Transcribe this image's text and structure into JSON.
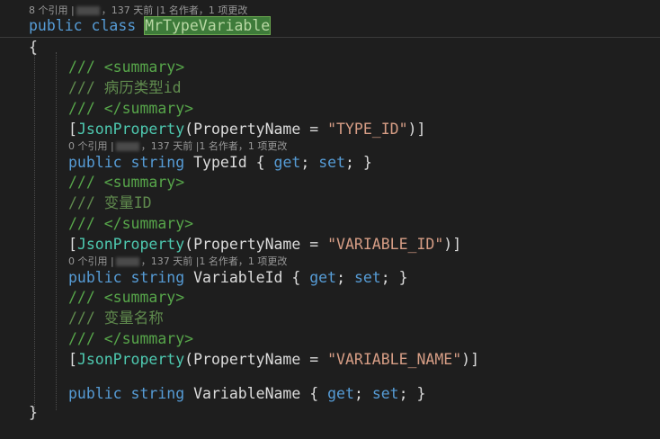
{
  "codelens": {
    "class": {
      "refs": "8 个引用",
      "sep1": "|",
      "time": "，137 天前",
      "sep2": "|",
      "authors": "1 名作者，1 项更改"
    },
    "typeid": {
      "refs": "0 个引用",
      "sep1": "|",
      "time": "，137 天前",
      "sep2": "|",
      "authors": "1 名作者，1 项更改"
    },
    "variableid": {
      "refs": "0 个引用",
      "sep1": "|",
      "time": "，137 天前",
      "sep2": "|",
      "authors": "1 名作者，1 项更改"
    }
  },
  "code": {
    "public": "public",
    "class": "class",
    "string": "string",
    "class_name": "MrTypeVariable",
    "open_brace": "{",
    "close_brace": "}",
    "summary_open": "/// <summary>",
    "summary_close": "/// </summary>",
    "json_property": "JsonProperty",
    "property_name": "PropertyName",
    "members": [
      {
        "comment": "/// 病历类型id",
        "json_value": "\"TYPE_ID\"",
        "name": "TypeId",
        "accessors": "{ get; set; }"
      },
      {
        "comment": "/// 变量ID",
        "json_value": "\"VARIABLE_ID\"",
        "name": "VariableId",
        "accessors": "{ get; set; }"
      },
      {
        "comment": "/// 变量名称",
        "json_value": "\"VARIABLE_NAME\"",
        "name": "VariableName",
        "accessors": "{ get; set; }"
      }
    ]
  }
}
